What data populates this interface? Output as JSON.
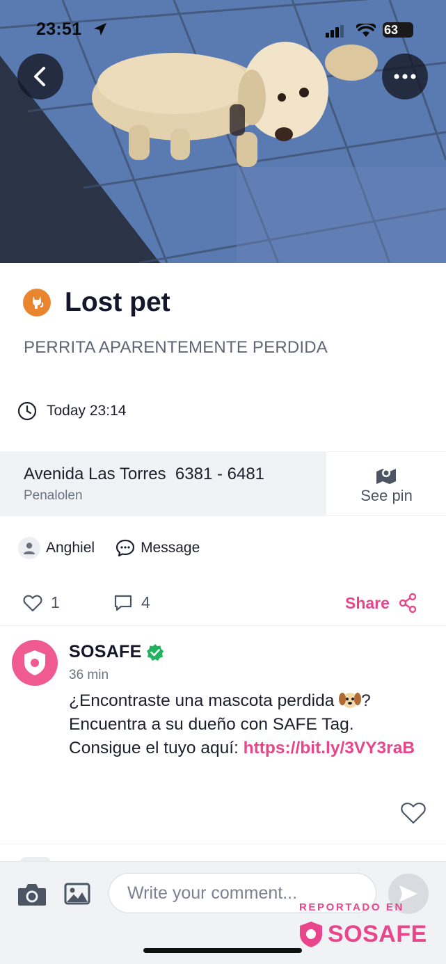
{
  "status_bar": {
    "time": "23:51",
    "battery": "63",
    "icons": [
      "location-arrow-icon",
      "signal-icon",
      "wifi-icon",
      "battery-icon"
    ]
  },
  "header": {
    "back_icon": "chevron-left-icon",
    "more_icon": "more-dots-icon",
    "photo_subject": "small white dog on blue tile floor"
  },
  "report": {
    "category_icon": "cat-icon",
    "title": "Lost pet",
    "description": "PERRITA APARENTEMENTE PERDIDA",
    "time_icon": "clock-icon",
    "time": "Today 23:14"
  },
  "address": {
    "street": "Avenida Las Torres  6381 - 6481",
    "area": "Penalolen",
    "see_pin_icon": "map-pin-icon",
    "see_pin_label": "See pin"
  },
  "author": {
    "name": "Anghiel",
    "message_label": "Message"
  },
  "actions": {
    "likes": "1",
    "comments": "4",
    "share_label": "Share"
  },
  "comment": {
    "author": "SOSAFE",
    "verified": true,
    "time": "36 min",
    "text_before": "¿Encontraste una mascota perdida ",
    "emoji": "dog-face-emoji",
    "text_after": "? Encuentra a su dueño con SAFE Tag. Consigue el tuyo aquí: ",
    "link": "https://bit.ly/3VY3raB"
  },
  "composer": {
    "placeholder": "Write your comment..."
  },
  "watermark": {
    "top": "REPORTADO EN",
    "brand": "SOSAFE"
  },
  "colors": {
    "accent": "#e8458b",
    "category": "#e9852f",
    "verified": "#22b35e"
  }
}
